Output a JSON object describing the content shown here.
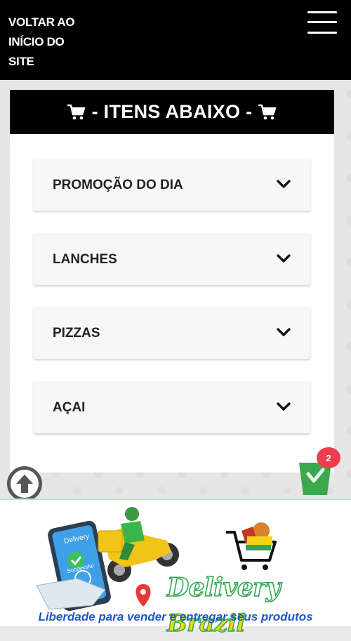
{
  "topbar": {
    "back_link": "VOLTAR AO INÍCIO DO SITE",
    "menu_icon": "hamburger-icon"
  },
  "panel": {
    "title": "- ITENS ABAIXO -",
    "title_icon": "cart-icon"
  },
  "accordion": {
    "items": [
      {
        "label": "PROMOÇÃO DO DIA",
        "icon": "chevron-down-icon"
      },
      {
        "label": "LANCHES",
        "icon": "chevron-down-icon"
      },
      {
        "label": "PIZZAS",
        "icon": "chevron-down-icon"
      },
      {
        "label": "AÇAI",
        "icon": "chevron-down-icon"
      }
    ]
  },
  "floating": {
    "scroll_top_icon": "arrow-up-icon",
    "cart_icon": "basket-icon",
    "cart_count": "2"
  },
  "banner": {
    "phone_screen_text": "Delivery",
    "phone_success_text": "Successful",
    "brand_part1": "Delivery",
    "brand_part2": "Brazil",
    "tagline": "Liberdade para vender e entregar seus produtos"
  },
  "colors": {
    "topbar_bg": "#000000",
    "badge": "#ee3d4f",
    "basket": "#3aa84c",
    "brand_green": "#2fa84f",
    "brand_yellow": "#f5d416",
    "tagline": "#1f57c9"
  }
}
